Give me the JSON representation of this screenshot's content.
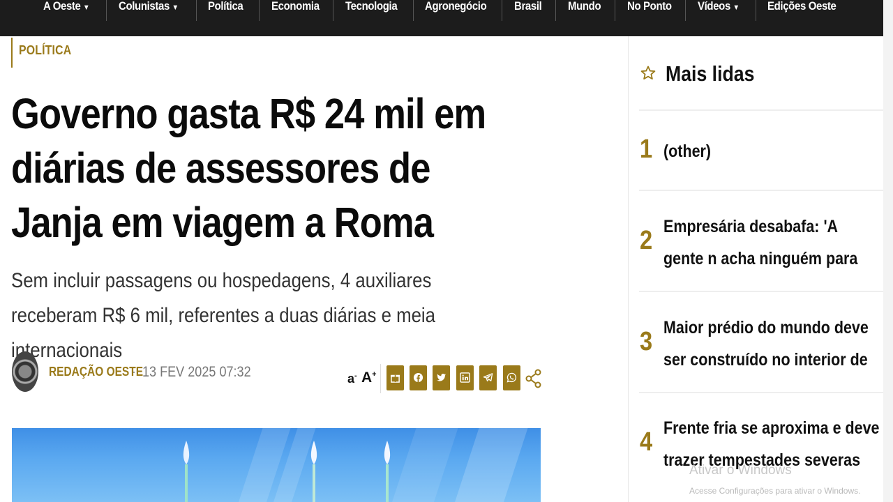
{
  "nav": {
    "items": [
      {
        "label": "A Oeste",
        "dropdown": true
      },
      {
        "label": "Colunistas",
        "dropdown": true
      },
      {
        "label": "Política",
        "dropdown": false
      },
      {
        "label": "Economia",
        "dropdown": false
      },
      {
        "label": "Tecnologia",
        "dropdown": false
      },
      {
        "label": "Agronegócio",
        "dropdown": false
      },
      {
        "label": "Brasil",
        "dropdown": false
      },
      {
        "label": "Mundo",
        "dropdown": false
      },
      {
        "label": "No Ponto",
        "dropdown": false
      },
      {
        "label": "Vídeos",
        "dropdown": true
      },
      {
        "label": "Edições Oeste",
        "dropdown": false
      }
    ]
  },
  "article": {
    "category": "POLÍTICA",
    "title": "Governo gasta R$ 24 mil em diárias de assessores de Janja em viagem a Roma",
    "subtitle": "Sem incluir passagens ou hospedagens, 4 auxiliares receberam R$ 6 mil, referentes a duas diárias e meia internacionais",
    "author": "REDAÇÃO OESTE",
    "separator": "·",
    "date": "13 FEV 2025 07:32",
    "font_small_label": "a",
    "font_small_sup": "-",
    "font_large_label": "A",
    "font_large_sup": "+"
  },
  "share": {
    "buttons": [
      "gift-icon",
      "facebook-icon",
      "twitter-icon",
      "linkedin-icon",
      "telegram-icon",
      "whatsapp-icon"
    ],
    "accent": "#9a7a1a"
  },
  "sidebar": {
    "title": "Mais lidas",
    "items": [
      {
        "rank": "1",
        "text": "(other)"
      },
      {
        "rank": "2",
        "text": "Empresária desabafa: 'A gente n acha ninguém para trabalhar'"
      },
      {
        "rank": "3",
        "text": "Maior prédio do mundo deve ser construído no interior de SP"
      },
      {
        "rank": "4",
        "text": "Frente fria se aproxima e deve trazer tempestades severas"
      }
    ]
  },
  "watermark": {
    "line1": "Ativar o Windows",
    "line2": "Acesse Configurações para ativar o Windows."
  },
  "colors": {
    "nav_bg": "#1c1c1c",
    "accent": "#9a7a1a",
    "text": "#111111"
  }
}
